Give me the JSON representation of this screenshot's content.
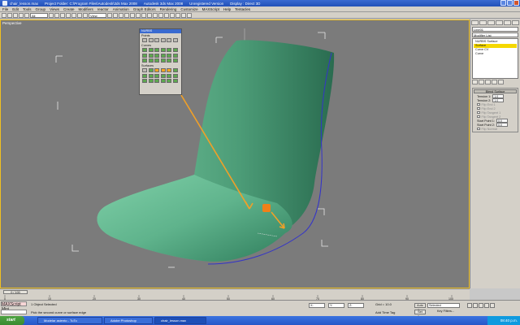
{
  "window": {
    "file": "chair_lesson.max",
    "project": "Project Folder: C:\\Program Files\\Autodesk\\3ds Max 2008",
    "app": "Autodesk 3ds Max 2008",
    "version": "Unregistered Version",
    "display": "Display : Direct 3D"
  },
  "menu": [
    "File",
    "Edit",
    "Tools",
    "Group",
    "Views",
    "Create",
    "Modifiers",
    "reactor",
    "Animation",
    "Graph Editors",
    "Rendering",
    "Customize",
    "MAXScript",
    "Help",
    "Tentacles"
  ],
  "toolbar": {
    "selection_filter": "All",
    "ref_coord": "View"
  },
  "viewport": {
    "label": "Perspective"
  },
  "nurbs_panel": {
    "title": "NURBS",
    "sections": [
      "Points",
      "Curves",
      "Surfaces"
    ]
  },
  "command_panel": {
    "object_name": "Line01",
    "modifier_list": "Modifier List",
    "stack": [
      "NURBS Surface",
      "Surface",
      "Curve CV",
      "Curve"
    ],
    "rollout_title": "Blend Surface",
    "tension1_label": "Tension 1:",
    "tension1_value": "1.0",
    "tension2_label": "Tension 2:",
    "tension2_value": "1.0",
    "flip_end1": "Flip End 1",
    "flip_end2": "Flip End 2",
    "flip_tangent1": "Flip Tangent 1",
    "flip_tangent2": "Flip Tangent 2",
    "start_point1_label": "Start Point 1:",
    "start_point1_value": "0.0",
    "start_point2_label": "Start Point 2:",
    "start_point2_value": "0.0",
    "flip_normal": "Flip Normal"
  },
  "timeline": {
    "slider": "0 / 100",
    "ticks": [
      "0",
      "10",
      "20",
      "30",
      "40",
      "50",
      "60",
      "70",
      "80",
      "90",
      "100"
    ]
  },
  "status": {
    "maxscript": "MAXScript Mini",
    "selected": "1 Object Selected",
    "prompt": "Pick the second curve or surface edge",
    "x": "X:",
    "y": "Y:",
    "z": "Z:",
    "grid": "Grid = 10.0",
    "auto_key": "Auto Key",
    "selected_dropdown": "Selected",
    "set_key": "Set Key",
    "key_filters": "Key Filters...",
    "add_time_tag": "Add Time Tag"
  },
  "taskbar": {
    "start": "start",
    "tasks": [
      "Modelar asiento - TuTo",
      "Adobe Photoshop",
      "chair_lesson.max"
    ],
    "clock": "08:40 p.m."
  },
  "colors": {
    "surface": "#5fb38c",
    "viewport_bg": "#7b7b7b",
    "arrow": "#f0a028",
    "viewport_border": "#f0c020"
  }
}
